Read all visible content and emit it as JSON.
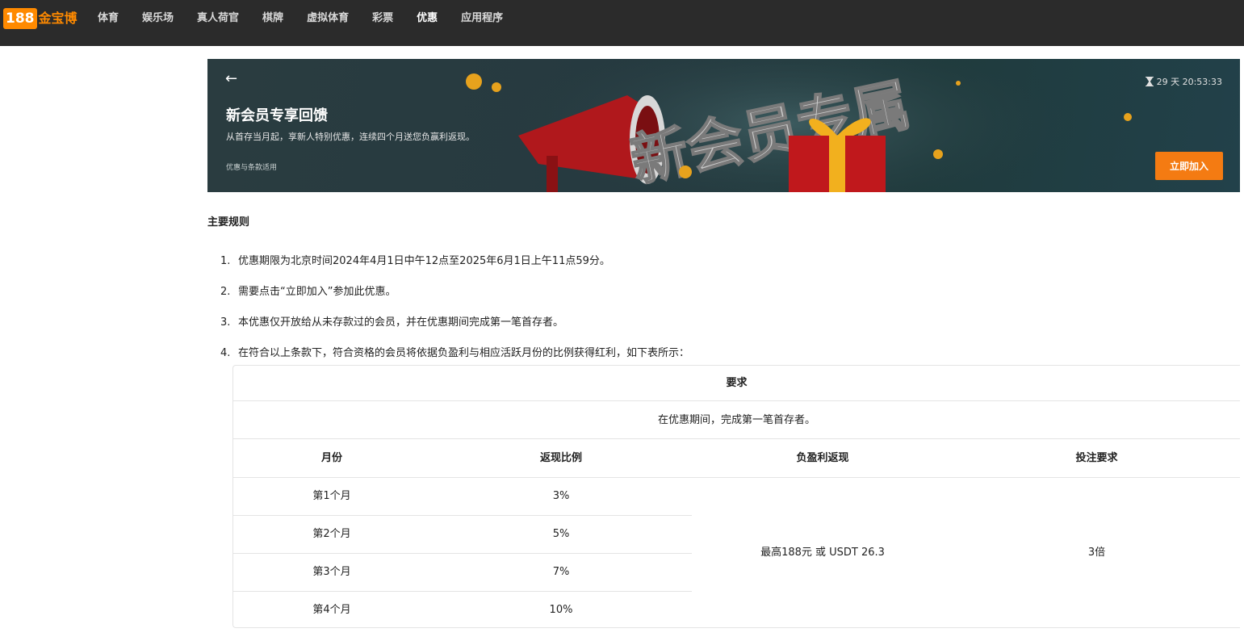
{
  "nav": {
    "logo_num": "188",
    "logo_text": "金宝博",
    "items": [
      "体育",
      "娱乐场",
      "真人荷官",
      "棋牌",
      "虚拟体育",
      "彩票",
      "优惠",
      "应用程序"
    ],
    "active": "优惠"
  },
  "banner": {
    "back_icon": "←",
    "title": "新会员专享回馈",
    "subtitle": "从首存当月起，享新人特别优惠，连续四个月送您负赢利返现。",
    "terms": "优惠与条款适用",
    "timer": "29 天 20:53:33",
    "join_label": "立即加入",
    "art_text": "新会员专属",
    "accent": "#f47b12"
  },
  "rules": {
    "title": "主要规则",
    "items": [
      {
        "num": "1.",
        "text": "优惠期限为北京时间2024年4月1日中午12点至2025年6月1日上午11点59分。"
      },
      {
        "num": "2.",
        "text": "需要点击“立即加入”参加此优惠。"
      },
      {
        "num": "3.",
        "text": "本优惠仅开放给从未存款过的会员，并在优惠期间完成第一笔首存者。"
      },
      {
        "num": "4.",
        "text": "在符合以上条款下，符合资格的会员将依据负盈利与相应活跃月份的比例获得红利，如下表所示："
      }
    ]
  },
  "table": {
    "requirement_header": "要求",
    "requirement_text": "在优惠期间，完成第一笔首存者。",
    "columns": [
      "月份",
      "返现比例",
      "负盈利返现",
      "投注要求"
    ],
    "rows": [
      {
        "month": "第1个月",
        "rate": "3%"
      },
      {
        "month": "第2个月",
        "rate": "5%"
      },
      {
        "month": "第3个月",
        "rate": "7%"
      },
      {
        "month": "第4个月",
        "rate": "10%"
      }
    ],
    "cashback": "最高188元 或 USDT 26.3",
    "wager": "3倍"
  }
}
